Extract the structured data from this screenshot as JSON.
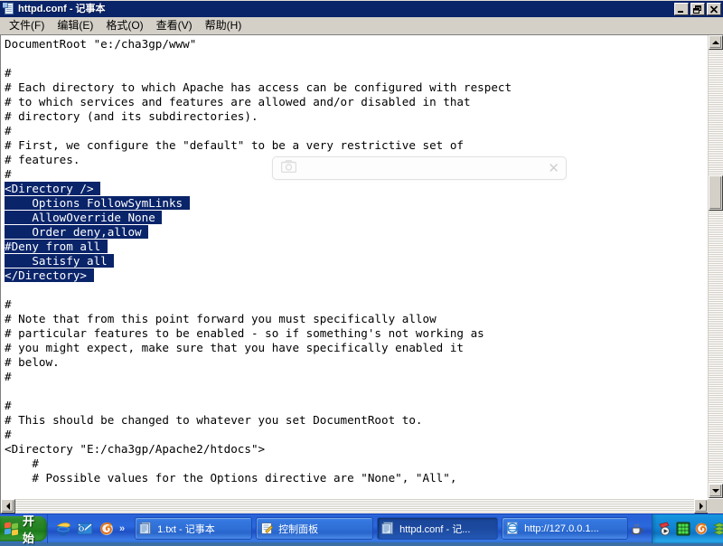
{
  "window": {
    "title": "httpd.conf - 记事本",
    "icon": "notepad-icon",
    "buttons": {
      "minimize": "_",
      "maximize": "❐",
      "close": "✕"
    },
    "menus": [
      {
        "label": "文件(F)",
        "key": "F"
      },
      {
        "label": "编辑(E)",
        "key": "E"
      },
      {
        "label": "格式(O)",
        "key": "O"
      },
      {
        "label": "查看(V)",
        "key": "V"
      },
      {
        "label": "帮助(H)",
        "key": "H"
      }
    ]
  },
  "editor": {
    "selection_color": "#0a246a",
    "background": "#ffffff",
    "text_color": "#000000",
    "lines": [
      {
        "text": "DocumentRoot \"e:/cha3gp/www\"",
        "selected": false
      },
      {
        "text": "",
        "selected": false
      },
      {
        "text": "#",
        "selected": false
      },
      {
        "text": "# Each directory to which Apache has access can be configured with respect",
        "selected": false
      },
      {
        "text": "# to which services and features are allowed and/or disabled in that",
        "selected": false
      },
      {
        "text": "# directory (and its subdirectories).",
        "selected": false
      },
      {
        "text": "#",
        "selected": false
      },
      {
        "text": "# First, we configure the \"default\" to be a very restrictive set of",
        "selected": false
      },
      {
        "text": "# features.",
        "selected": false
      },
      {
        "text": "#",
        "selected": false
      },
      {
        "text": "<Directory />",
        "selected": true
      },
      {
        "text": "    Options FollowSymLinks",
        "selected": true
      },
      {
        "text": "    AllowOverride None",
        "selected": true
      },
      {
        "text": "    Order deny,allow",
        "selected": true
      },
      {
        "text": "#Deny from all",
        "selected": true
      },
      {
        "text": "    Satisfy all",
        "selected": true
      },
      {
        "text": "</Directory>",
        "selected": true
      },
      {
        "text": "",
        "selected": false
      },
      {
        "text": "#",
        "selected": false
      },
      {
        "text": "# Note that from this point forward you must specifically allow",
        "selected": false
      },
      {
        "text": "# particular features to be enabled - so if something's not working as",
        "selected": false
      },
      {
        "text": "# you might expect, make sure that you have specifically enabled it",
        "selected": false
      },
      {
        "text": "# below.",
        "selected": false
      },
      {
        "text": "#",
        "selected": false
      },
      {
        "text": "",
        "selected": false
      },
      {
        "text": "#",
        "selected": false
      },
      {
        "text": "# This should be changed to whatever you set DocumentRoot to.",
        "selected": false
      },
      {
        "text": "#",
        "selected": false
      },
      {
        "text": "<Directory \"E:/cha3gp/Apache2/htdocs\">",
        "selected": false
      },
      {
        "text": "    #",
        "selected": false
      },
      {
        "text": "    # Possible values for the Options directive are \"None\", \"All\",",
        "selected": false
      }
    ]
  },
  "overlay": {
    "icon": "camera-icon",
    "close_label": "✕",
    "text": ""
  },
  "taskbar": {
    "start_label": "开始",
    "quicklaunch": [
      {
        "name": "internet-explorer-icon"
      },
      {
        "name": "outlook-express-icon"
      },
      {
        "name": "firefox-icon"
      }
    ],
    "overflow_label": "»",
    "tasks": [
      {
        "label": "1.txt - 记事本",
        "icon": "notepad-icon",
        "active": false
      },
      {
        "label": "控制面板",
        "icon": "control-panel-icon",
        "active": false
      },
      {
        "label": "httpd.conf - 记...",
        "icon": "notepad-icon",
        "active": true
      },
      {
        "label": "http://127.0.0.1...",
        "icon": "internet-explorer-icon",
        "active": false
      }
    ],
    "tray": [
      {
        "name": "java-coffee-icon"
      },
      {
        "name": "media-player-icon"
      },
      {
        "name": "green-grid-icon"
      },
      {
        "name": "firefox-icon"
      },
      {
        "name": "green-stack-icon"
      },
      {
        "name": "green-download-icon"
      },
      {
        "name": "network-icon"
      },
      {
        "name": "green-arrows-icon"
      }
    ]
  },
  "scrollbars": {
    "vertical": {
      "up_arrow": "▲",
      "down_arrow": "▼",
      "thumb_top_pct": 29,
      "thumb_height_pct": 8
    },
    "horizontal": {
      "left_arrow": "◀",
      "right_arrow": "▶"
    }
  }
}
